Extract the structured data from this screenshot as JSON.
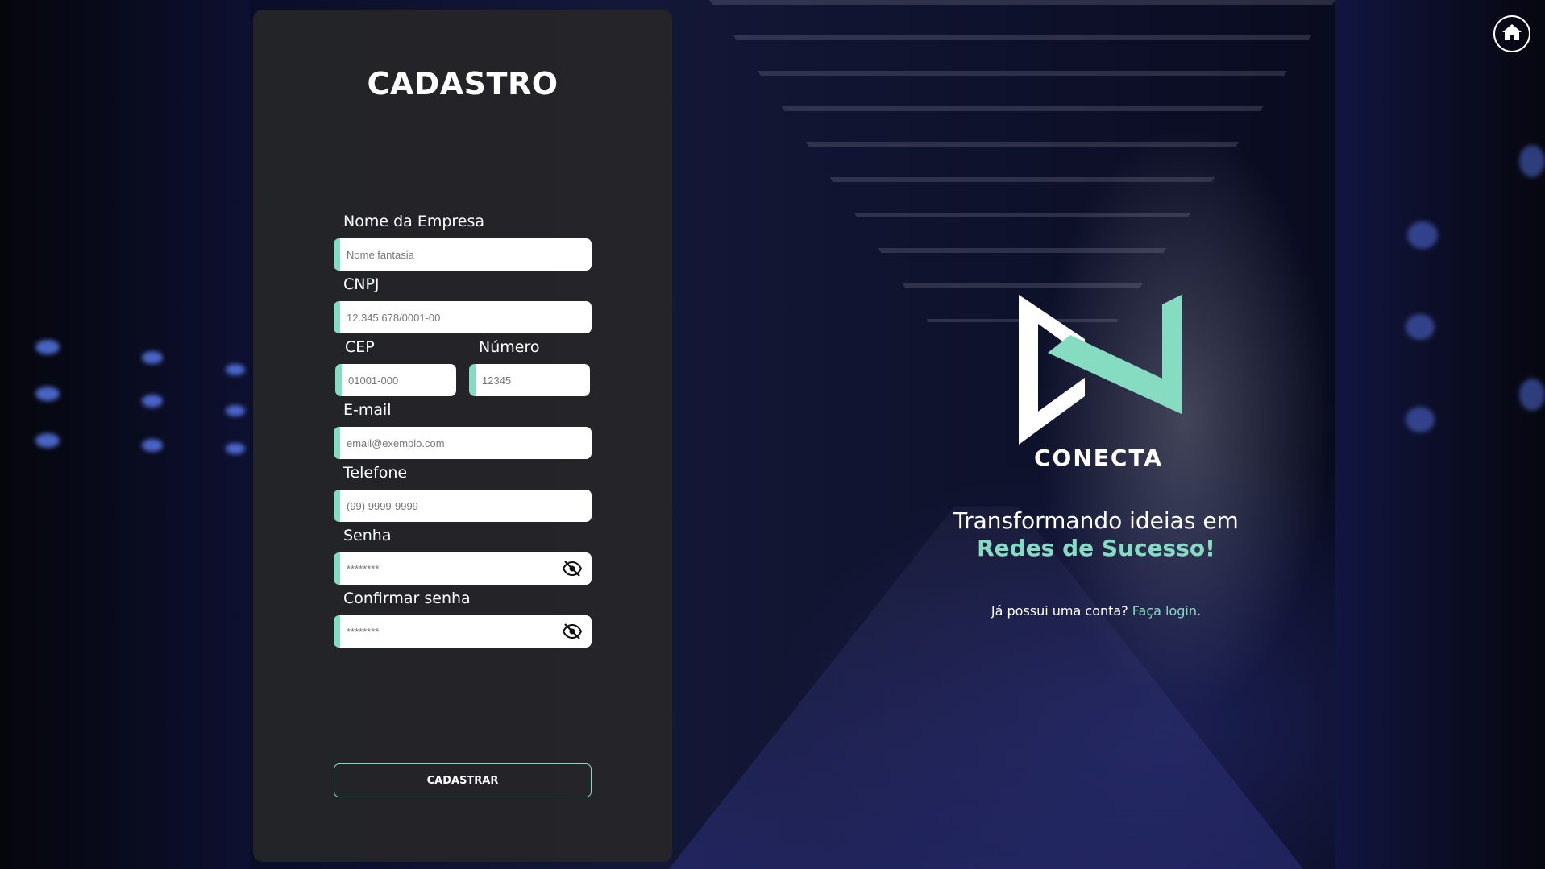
{
  "form": {
    "title": "CADASTRO",
    "fields": {
      "company_name": {
        "label": "Nome da Empresa",
        "placeholder": "Nome fantasia"
      },
      "cnpj": {
        "label": "CNPJ",
        "placeholder": "12.345.678/0001-00"
      },
      "cep": {
        "label": "CEP",
        "placeholder": "01001-000"
      },
      "number": {
        "label": "Número",
        "placeholder": "12345"
      },
      "email": {
        "label": "E-mail",
        "placeholder": "email@exemplo.com"
      },
      "phone": {
        "label": "Telefone",
        "placeholder": "(99) 9999-9999"
      },
      "password": {
        "label": "Senha",
        "placeholder": "********"
      },
      "confirm_password": {
        "label": "Confirmar senha",
        "placeholder": "********"
      }
    },
    "submit_label": "CADASTRAR"
  },
  "brand": {
    "name": "CONECTA",
    "tagline_line1": "Transformando ideias em",
    "tagline_highlight": "Redes de Sucesso!",
    "login_prompt": "Já possui uma conta?",
    "login_link": "Faça login",
    "login_suffix": "."
  },
  "colors": {
    "accent": "#86dcc0",
    "panel": "#262628"
  },
  "icons": {
    "home": "home-icon",
    "toggle_password": "eye-off-icon"
  }
}
